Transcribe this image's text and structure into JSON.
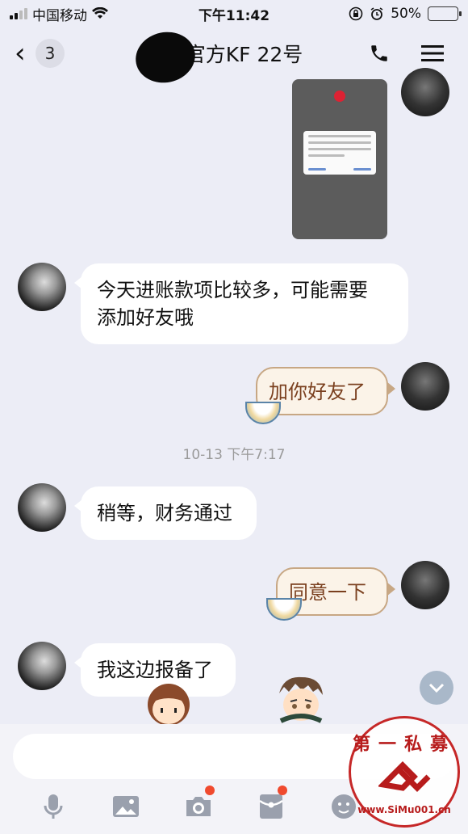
{
  "status_bar": {
    "carrier": "中国移动",
    "time": "下午11:42",
    "battery": "50%",
    "battery_level": 0.5
  },
  "nav": {
    "unread_count": "3",
    "title": "惠官方KF 22号"
  },
  "messages": [
    {
      "side": "left",
      "text": "今天进账款项比较多，可能需要\n添加好友哦"
    },
    {
      "side": "right",
      "text": "加你好友了"
    },
    {
      "side": "left",
      "text": "稍等，财务通过"
    },
    {
      "side": "right",
      "text": "同意一下"
    },
    {
      "side": "left",
      "text": "我这边报备了"
    }
  ],
  "timestamp": "10-13 下午7:17",
  "input": {
    "placeholder": ""
  },
  "watermark": {
    "top_text": "第一私募",
    "bottom_text": "www.SiMu001.cn"
  },
  "colors": {
    "background": "#ecedf6",
    "right_bubble_bg": "#fbf3e8",
    "right_bubble_border": "#c7a784",
    "right_bubble_text": "#7a3f1e",
    "badge_dot": "#f04a2e",
    "watermark": "#c62828"
  },
  "icons": {
    "back": "chevron-left-icon",
    "phone": "phone-icon",
    "menu": "menu-icon",
    "toolbar": [
      "microphone-icon",
      "image-icon",
      "camera-icon",
      "red-packet-icon",
      "emoji-icon"
    ],
    "scroll_down": "chevron-down-icon"
  }
}
